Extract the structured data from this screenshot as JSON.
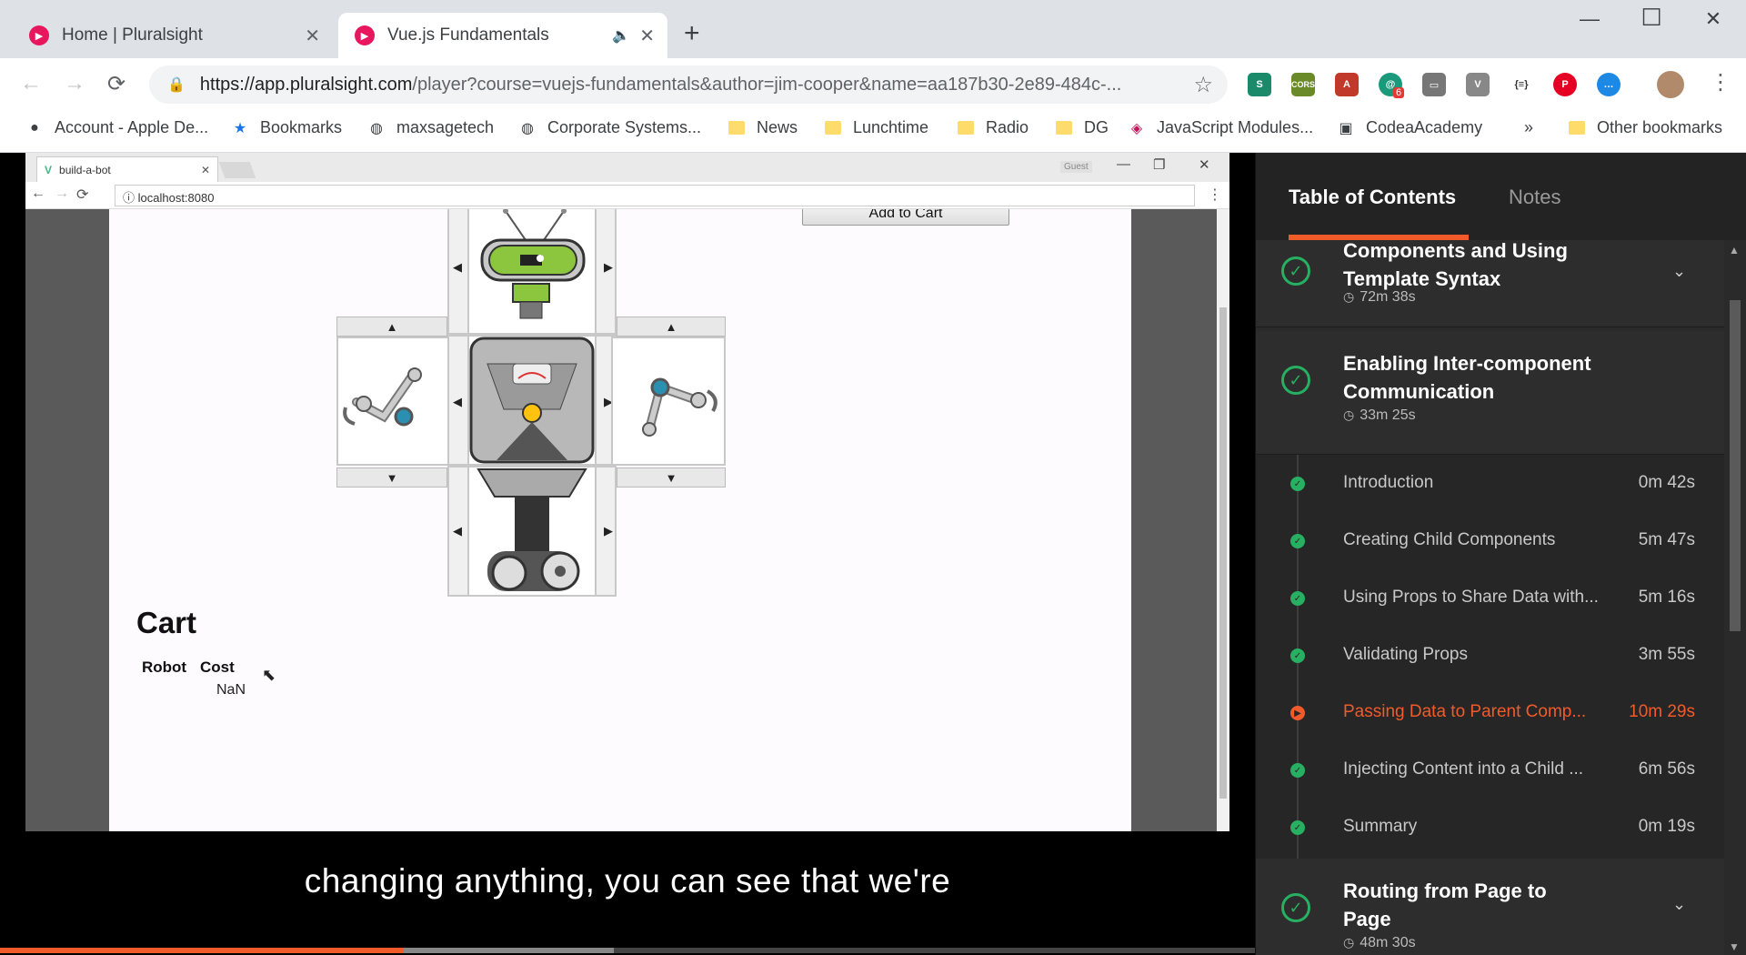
{
  "browser": {
    "tabs": [
      {
        "title": "Home | Pluralsight",
        "active": false
      },
      {
        "title": "Vue.js Fundamentals",
        "active": true
      }
    ],
    "url_host": "https://app.pluralsight.com",
    "url_path": "/player?course=vuejs-fundamentals&author=jim-cooper&name=aa187b30-2e89-484c-...",
    "extension_badge": "6",
    "bookmarks": [
      {
        "label": "Account - Apple De...",
        "icon": "apple-icon"
      },
      {
        "label": "Bookmarks",
        "icon": "star-icon"
      },
      {
        "label": "maxsagetech",
        "icon": "globe-icon"
      },
      {
        "label": "Corporate Systems...",
        "icon": "globe-icon"
      },
      {
        "label": "News",
        "icon": "folder-icon"
      },
      {
        "label": "Lunchtime",
        "icon": "folder-icon"
      },
      {
        "label": "Radio",
        "icon": "folder-icon"
      },
      {
        "label": "DG",
        "icon": "folder-icon"
      },
      {
        "label": "JavaScript Modules...",
        "icon": "page-icon"
      },
      {
        "label": "CodeaAcademy",
        "icon": "page-icon"
      }
    ],
    "bookmarks_overflow": "»",
    "other_bookmarks": "Other bookmarks"
  },
  "inner_browser": {
    "tab_title": "build-a-bot",
    "guest_label": "Guest",
    "address": "localhost:8080"
  },
  "robot_builder": {
    "add_to_cart": "Add to Cart",
    "arrow_up": "▲",
    "arrow_down": "▼",
    "arrow_left": "◀",
    "arrow_right": "▶",
    "cart": {
      "title": "Cart",
      "columns": [
        "Robot",
        "Cost"
      ],
      "rows": [
        {
          "robot": "",
          "cost": "NaN"
        }
      ]
    }
  },
  "player": {
    "caption": "changing anything, you can see that we're",
    "progress_fraction": 0.322,
    "buffered_fraction": 0.489
  },
  "panel": {
    "tabs": {
      "toc": "Table of Contents",
      "notes": "Notes"
    },
    "modules": [
      {
        "title_line1": "Components and Using",
        "title_line2": "Template Syntax",
        "duration": "72m 38s",
        "completed": true,
        "expanded": false
      },
      {
        "title_line1": "Enabling Inter-component",
        "title_line2": "Communication",
        "duration": "33m 25s",
        "completed": true,
        "expanded": true
      },
      {
        "title_line1": "Routing from Page to",
        "title_line2": "Page",
        "duration": "48m 30s",
        "completed": true,
        "expanded": false
      }
    ],
    "clips": [
      {
        "title": "Introduction",
        "duration": "0m 42s",
        "state": "watched"
      },
      {
        "title": "Creating Child Components",
        "duration": "5m 47s",
        "state": "watched"
      },
      {
        "title": "Using Props to Share Data with...",
        "duration": "5m 16s",
        "state": "watched"
      },
      {
        "title": "Validating Props",
        "duration": "3m 55s",
        "state": "watched"
      },
      {
        "title": "Passing Data to Parent Comp...",
        "duration": "10m 29s",
        "state": "current"
      },
      {
        "title": "Injecting Content into a Child ...",
        "duration": "6m 56s",
        "state": "watched"
      },
      {
        "title": "Summary",
        "duration": "0m 19s",
        "state": "watched"
      }
    ]
  },
  "colors": {
    "accent": "#f15b2a",
    "complete": "#27b062",
    "panel_bg": "#2a2a2a"
  }
}
